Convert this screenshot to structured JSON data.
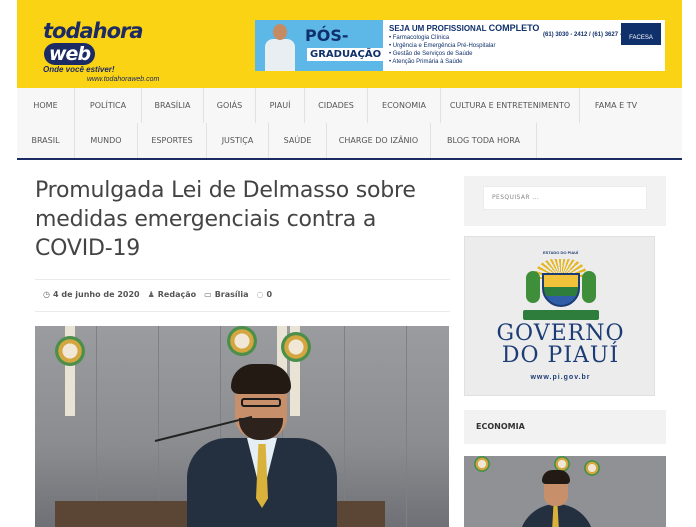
{
  "header": {
    "logo": {
      "main": "todahora",
      "web": "web",
      "slogan": "Onde você estiver!",
      "url": "www.todahoraweb.com"
    },
    "banner": {
      "pos": "PÓS-",
      "graduacao": "GRADUAÇÃO",
      "title_prefix": "SEJA UM PROFISSIONAL",
      "title_strong": "COMPLETO",
      "courses": [
        "• Farmacologia Clínica",
        "• Urgência e Emergência Pré-Hospitalar",
        "• Gestão de Serviços de Saúde",
        "• Atenção Primária à Saúde"
      ],
      "brand": "FACESA",
      "phones": "(61) 3030 - 2412 / (61) 3627 - 4200"
    }
  },
  "nav": {
    "row1": [
      "HOME",
      "POLÍTICA",
      "BRASÍLIA",
      "GOIÁS",
      "PIAUÍ",
      "CIDADES",
      "ECONOMIA",
      "CULTURA E ENTRETENIMENTO",
      "FAMA E TV"
    ],
    "row2": [
      "BRASIL",
      "MUNDO",
      "ESPORTES",
      "JUSTIÇA",
      "SAÚDE",
      "CHARGE DO IZÂNIO",
      "BLOG TODA HORA"
    ]
  },
  "article": {
    "title": "Promulgada Lei de Delmasso sobre medidas emergenciais contra a COVID-19",
    "date": "4 de junho de 2020",
    "author": "Redação",
    "category": "Brasília",
    "comments": "0"
  },
  "sidebar": {
    "search_placeholder": "PESQUISAR ...",
    "gov": {
      "state": "ESTADO DO PIAUÍ",
      "line1": "GOVERNO",
      "line2": "DO PIAUÍ",
      "url": "www.pi.gov.br"
    },
    "section_label": "ECONOMIA"
  },
  "colors": {
    "header_bg": "#fbd315",
    "brand_navy": "#1c2b63",
    "nav_bg": "#f7f7f7"
  }
}
